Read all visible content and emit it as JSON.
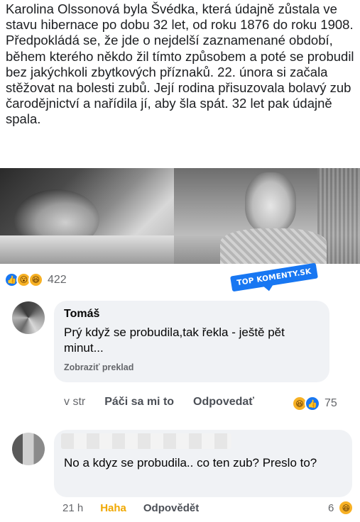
{
  "post": {
    "paragraphs": [
      "Karolina Olssonová byla Švédka, která údajně zůstala ve stavu hibernace po dobu 32 let, od roku 1876 do roku 1908.",
      "Předpokládá se, že jde o nejdelší zaznamenané období, během kterého někdo žil tímto způsobem a poté se probudil bez jakýchkoli zbytkových příznaků. 22. února si začala stěžovat na bolesti zubů. Její rodina přisuzovala bolavý zub čarodějnictví a nařídila jí, aby šla spát. 32 let pak údajně spala."
    ],
    "reaction_count": "422",
    "reaction_icons": [
      "like-icon",
      "wow-icon",
      "haha-icon"
    ]
  },
  "watermark": {
    "text": "TOP KOMENTY.SK"
  },
  "comments": [
    {
      "author": "Tomáš",
      "text": "Prý když se probudila,tak řekla - ještě pět minut...",
      "translate": "Zobraziť preklad",
      "time": "v str",
      "like": "Páči sa mi to",
      "reply": "Odpovedať",
      "reaction_count": "75"
    },
    {
      "text": "No a kdyz se probudila.. co ten zub? Preslo to?",
      "time": "21 h",
      "like": "Haha",
      "reply": "Odpovědět",
      "reaction_count": "6"
    }
  ],
  "colors": {
    "accent": "#1877f2",
    "bubble": "#f0f2f5",
    "haha": "#f0a800"
  }
}
